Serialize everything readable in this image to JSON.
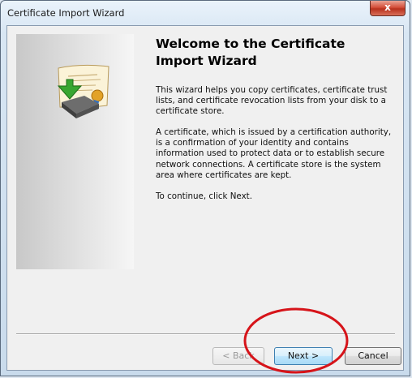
{
  "window": {
    "title": "Certificate Import Wizard",
    "close_glyph": "x"
  },
  "content": {
    "heading": "Welcome to the Certificate Import Wizard",
    "paragraphs": [
      "This wizard helps you copy certificates, certificate trust lists, and certificate revocation lists from your disk to a certificate store.",
      "A certificate, which is issued by a certification authority, is a confirmation of your identity and contains information used to protect data or to establish secure network connections. A certificate store is the system area where certificates are kept.",
      "To continue, click Next."
    ]
  },
  "buttons": {
    "back": "< Back",
    "next": "Next >",
    "cancel": "Cancel"
  },
  "icons": {
    "wizard_art": "certificate-import-icon",
    "close": "close-icon"
  },
  "colors": {
    "highlight": "#d6141a",
    "accent": "#3c7fb1"
  }
}
